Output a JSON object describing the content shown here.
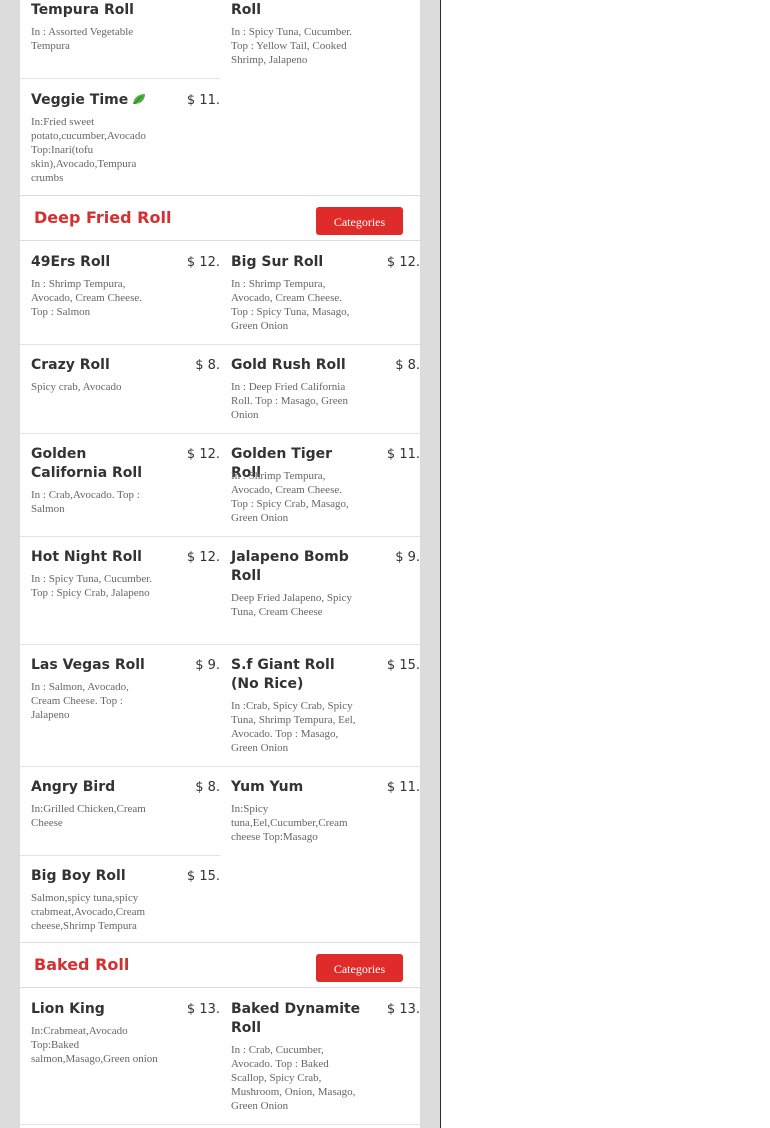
{
  "colors": {
    "accent": "#e02b2b",
    "section_title": "#d62f2f",
    "gutter": "#dcdcdc"
  },
  "top_items": {
    "tempura": {
      "name": "Tempura Roll",
      "desc": "In : Assorted Vegetable Tempura"
    },
    "spicy_roll": {
      "name": "Roll",
      "desc": "In : Spicy Tuna, Cucumber. Top : Yellow Tail, Cooked Shrimp, Jalapeno"
    },
    "veggie": {
      "name": "Veggie Time",
      "price": "$ 11.",
      "desc": "In:Fried sweet potato,cucumber,Avocado Top:Inari(tofu skin),Avocado,Tempura crumbs",
      "icon": "leaf-icon"
    }
  },
  "deep_fried": {
    "title": "Deep Fried Roll",
    "button": "Categories",
    "items": [
      {
        "name": "49Ers Roll",
        "price": "$ 12.",
        "desc": "In : Shrimp Tempura, Avocado, Cream Cheese. Top : Salmon"
      },
      {
        "name": "Big Sur Roll",
        "price": "$ 12.",
        "desc": "In : Shrimp Tempura, Avocado, Cream Cheese. Top : Spicy Tuna, Masago, Green Onion"
      },
      {
        "name": "Crazy Roll",
        "price": "$ 8.",
        "desc": "Spicy crab, Avocado"
      },
      {
        "name": "Gold Rush Roll",
        "price": "$ 8.",
        "desc": "In : Deep Fried California Roll. Top : Masago, Green Onion"
      },
      {
        "name": "Golden California Roll",
        "price": "$ 12.",
        "desc": "In : Crab,Avocado. Top : Salmon"
      },
      {
        "name": "Golden Tiger Roll",
        "price": "$ 11.",
        "desc": "In : Shrimp Tempura, Avocado, Cream Cheese. Top : Spicy Crab, Masago, Green Onion"
      },
      {
        "name": "Hot Night Roll",
        "price": "$ 12.",
        "desc": "In : Spicy Tuna, Cucumber. Top : Spicy Crab, Jalapeno"
      },
      {
        "name": "Jalapeno Bomb Roll",
        "price": "$ 9.",
        "desc": "Deep Fried Jalapeno, Spicy Tuna, Cream Cheese"
      },
      {
        "name": "Las Vegas Roll",
        "price": "$ 9.",
        "desc": "In : Salmon, Avocado, Cream Cheese. Top : Jalapeno"
      },
      {
        "name": "S.f Giant Roll (No Rice)",
        "price": "$ 15.",
        "desc": "In :Crab, Spicy Crab, Spicy Tuna, Shrimp Tempura, Eel, Avocado. Top : Masago, Green Onion"
      },
      {
        "name": "Angry Bird",
        "price": "$ 8.",
        "desc": "In:Grilled Chicken,Cream Cheese"
      },
      {
        "name": "Yum Yum",
        "price": "$ 11.",
        "desc": "In:Spicy tuna,Eel,Cucumber,Cream cheese Top:Masago"
      },
      {
        "name": "Big Boy Roll",
        "price": "$ 15.",
        "desc": "Salmon,spicy tuna,spicy crabmeat,Avocado,Cream cheese,Shrimp Tempura"
      }
    ]
  },
  "baked": {
    "title": "Baked Roll",
    "button": "Categories",
    "items": [
      {
        "name": "Lion King",
        "price": "$ 13.",
        "desc": "In:Crabmeat,Avocado Top:Baked salmon,Masago,Green onion"
      },
      {
        "name": "Baked Dynamite Roll",
        "price": "$ 13.",
        "desc": "In : Crab, Cucumber, Avocado. Top : Baked Scallop, Spicy Crab, Mushroom, Onion, Masago, Green Onion"
      }
    ]
  }
}
